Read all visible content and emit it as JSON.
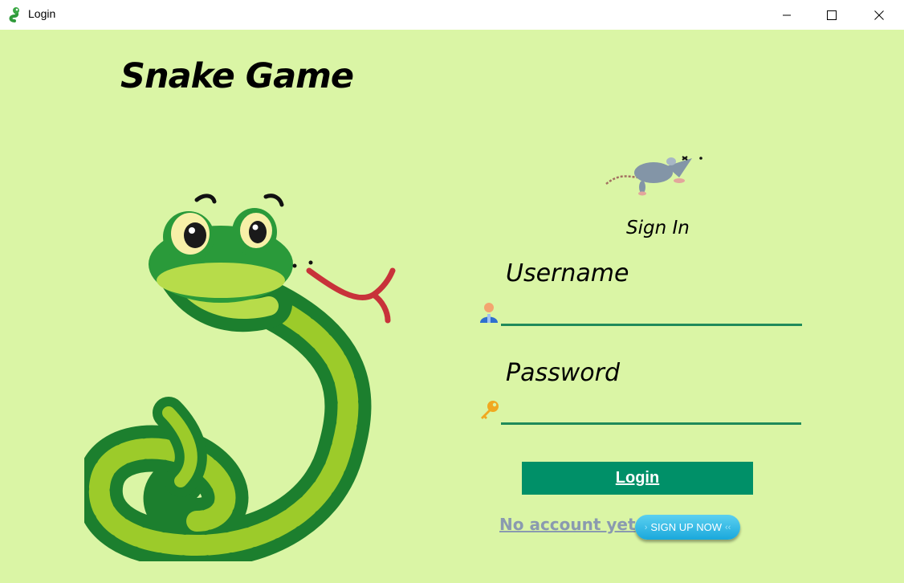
{
  "window": {
    "title": "Login",
    "app_icon": "snake-icon"
  },
  "controls": {
    "minimize": "minimize-icon",
    "maximize": "maximize-icon",
    "close": "close-icon"
  },
  "main": {
    "game_title": "Snake Game",
    "sign_in": "Sign In",
    "username_label": "Username",
    "password_label": "Password",
    "username_value": "",
    "password_value": "",
    "login_label": "Login",
    "no_account": "No account yet",
    "signup_label": "SIGN UP NOW",
    "signup_left": "›",
    "signup_right": "‹‹"
  },
  "colors": {
    "background": "#daf5a5",
    "accent": "#009068",
    "underline": "#1f8a5a",
    "link": "#8a9ab0",
    "signup": "#1aa8dc"
  }
}
